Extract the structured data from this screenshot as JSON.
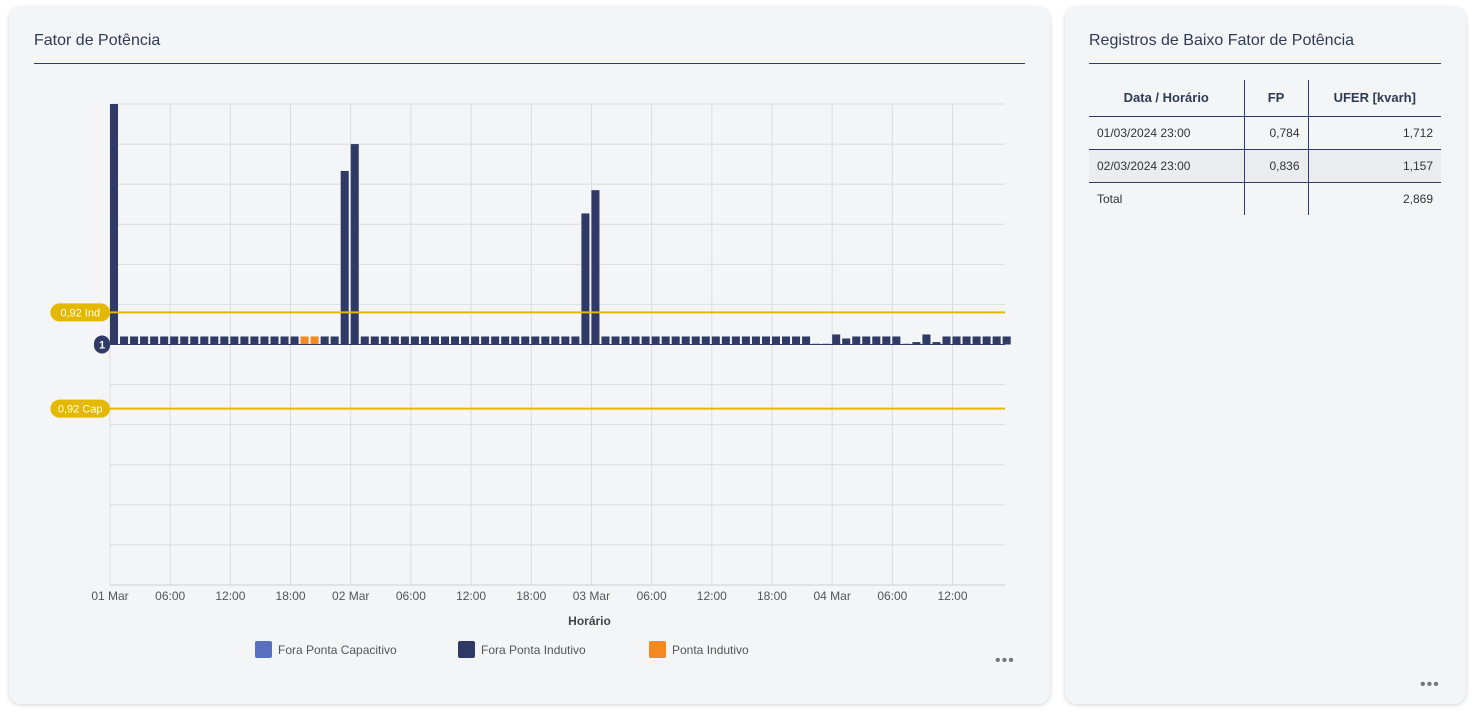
{
  "chart_card": {
    "title": "Fator de Potência",
    "more_label": "•••"
  },
  "table_card": {
    "title": "Registros de Baixo Fator de Potência",
    "more_label": "•••",
    "headers": [
      "Data / Horário",
      "FP",
      "UFER [kvarh]"
    ],
    "rows": [
      {
        "date": "01/03/2024 23:00",
        "fp": "0,784",
        "ufer": "1,712"
      },
      {
        "date": "02/03/2024 23:00",
        "fp": "0,836",
        "ufer": "1,157"
      }
    ],
    "total": {
      "label": "Total",
      "fp": "",
      "ufer": "2,869"
    }
  },
  "chart_data": {
    "type": "bar",
    "xlabel": "Horário",
    "x_ticks": [
      "01 Mar",
      "06:00",
      "12:00",
      "18:00",
      "02 Mar",
      "06:00",
      "12:00",
      "18:00",
      "03 Mar",
      "06:00",
      "12:00",
      "18:00",
      "04 Mar",
      "06:00",
      "12:00"
    ],
    "ylim": [
      0.4,
      1.6
    ],
    "baseline": 1,
    "baseline_label": "1",
    "reference_lines": [
      {
        "label": "0,92 Ind",
        "value": 1.08
      },
      {
        "label": "0,92 Cap",
        "value": 0.84
      }
    ],
    "series": [
      {
        "name": "Fora Ponta Capacitivo",
        "color": "#5a6fbf"
      },
      {
        "name": "Fora Ponta Indutivo",
        "color": "#2f3a66"
      },
      {
        "name": "Ponta Indutivo",
        "color": "#f5891f"
      }
    ],
    "bars": [
      {
        "h": 0,
        "v": 1.6,
        "s": 1
      },
      {
        "h": 1,
        "v": 1.02,
        "s": 1
      },
      {
        "h": 2,
        "v": 1.02,
        "s": 1
      },
      {
        "h": 3,
        "v": 1.02,
        "s": 1
      },
      {
        "h": 4,
        "v": 1.02,
        "s": 1
      },
      {
        "h": 5,
        "v": 1.02,
        "s": 1
      },
      {
        "h": 6,
        "v": 1.02,
        "s": 1
      },
      {
        "h": 7,
        "v": 1.02,
        "s": 1
      },
      {
        "h": 8,
        "v": 1.02,
        "s": 1
      },
      {
        "h": 9,
        "v": 1.02,
        "s": 1
      },
      {
        "h": 10,
        "v": 1.02,
        "s": 1
      },
      {
        "h": 11,
        "v": 1.02,
        "s": 1
      },
      {
        "h": 12,
        "v": 1.02,
        "s": 1
      },
      {
        "h": 13,
        "v": 1.02,
        "s": 1
      },
      {
        "h": 14,
        "v": 1.02,
        "s": 1
      },
      {
        "h": 15,
        "v": 1.02,
        "s": 1
      },
      {
        "h": 16,
        "v": 1.02,
        "s": 1
      },
      {
        "h": 17,
        "v": 1.02,
        "s": 1
      },
      {
        "h": 18,
        "v": 1.02,
        "s": 1
      },
      {
        "h": 19,
        "v": 1.02,
        "s": 2
      },
      {
        "h": 20,
        "v": 1.02,
        "s": 2
      },
      {
        "h": 21,
        "v": 1.02,
        "s": 1
      },
      {
        "h": 22,
        "v": 1.02,
        "s": 1
      },
      {
        "h": 23,
        "v": 1.433,
        "s": 1
      },
      {
        "h": 24,
        "v": 1.5,
        "s": 1
      },
      {
        "h": 25,
        "v": 1.02,
        "s": 1
      },
      {
        "h": 26,
        "v": 1.02,
        "s": 1
      },
      {
        "h": 27,
        "v": 1.02,
        "s": 1
      },
      {
        "h": 28,
        "v": 1.02,
        "s": 1
      },
      {
        "h": 29,
        "v": 1.02,
        "s": 1
      },
      {
        "h": 30,
        "v": 1.02,
        "s": 1
      },
      {
        "h": 31,
        "v": 1.02,
        "s": 1
      },
      {
        "h": 32,
        "v": 1.02,
        "s": 1
      },
      {
        "h": 33,
        "v": 1.02,
        "s": 1
      },
      {
        "h": 34,
        "v": 1.02,
        "s": 1
      },
      {
        "h": 35,
        "v": 1.02,
        "s": 1
      },
      {
        "h": 36,
        "v": 1.02,
        "s": 1
      },
      {
        "h": 37,
        "v": 1.02,
        "s": 1
      },
      {
        "h": 38,
        "v": 1.02,
        "s": 1
      },
      {
        "h": 39,
        "v": 1.02,
        "s": 1
      },
      {
        "h": 40,
        "v": 1.02,
        "s": 1
      },
      {
        "h": 41,
        "v": 1.02,
        "s": 1
      },
      {
        "h": 42,
        "v": 1.02,
        "s": 1
      },
      {
        "h": 43,
        "v": 1.02,
        "s": 1
      },
      {
        "h": 44,
        "v": 1.02,
        "s": 1
      },
      {
        "h": 45,
        "v": 1.02,
        "s": 1
      },
      {
        "h": 46,
        "v": 1.02,
        "s": 1
      },
      {
        "h": 47,
        "v": 1.327,
        "s": 1
      },
      {
        "h": 48,
        "v": 1.385,
        "s": 1
      },
      {
        "h": 49,
        "v": 1.02,
        "s": 1
      },
      {
        "h": 50,
        "v": 1.02,
        "s": 1
      },
      {
        "h": 51,
        "v": 1.02,
        "s": 1
      },
      {
        "h": 52,
        "v": 1.02,
        "s": 1
      },
      {
        "h": 53,
        "v": 1.02,
        "s": 1
      },
      {
        "h": 54,
        "v": 1.02,
        "s": 1
      },
      {
        "h": 55,
        "v": 1.02,
        "s": 1
      },
      {
        "h": 56,
        "v": 1.02,
        "s": 1
      },
      {
        "h": 57,
        "v": 1.02,
        "s": 1
      },
      {
        "h": 58,
        "v": 1.02,
        "s": 1
      },
      {
        "h": 59,
        "v": 1.02,
        "s": 1
      },
      {
        "h": 60,
        "v": 1.02,
        "s": 1
      },
      {
        "h": 61,
        "v": 1.02,
        "s": 1
      },
      {
        "h": 62,
        "v": 1.02,
        "s": 1
      },
      {
        "h": 63,
        "v": 1.02,
        "s": 1
      },
      {
        "h": 64,
        "v": 1.02,
        "s": 1
      },
      {
        "h": 65,
        "v": 1.02,
        "s": 1
      },
      {
        "h": 66,
        "v": 1.02,
        "s": 1
      },
      {
        "h": 67,
        "v": 1.02,
        "s": 1
      },
      {
        "h": 68,
        "v": 1.02,
        "s": 1
      },
      {
        "h": 69,
        "v": 1.02,
        "s": 1
      },
      {
        "h": 70,
        "v": 1.002,
        "s": 0
      },
      {
        "h": 71,
        "v": 1.002,
        "s": 0
      },
      {
        "h": 72,
        "v": 1.025,
        "s": 1
      },
      {
        "h": 73,
        "v": 1.015,
        "s": 1
      },
      {
        "h": 74,
        "v": 1.02,
        "s": 1
      },
      {
        "h": 75,
        "v": 1.02,
        "s": 1
      },
      {
        "h": 76,
        "v": 1.02,
        "s": 1
      },
      {
        "h": 77,
        "v": 1.02,
        "s": 1
      },
      {
        "h": 78,
        "v": 1.02,
        "s": 1
      },
      {
        "h": 79,
        "v": 1.002,
        "s": 0
      },
      {
        "h": 80,
        "v": 1.006,
        "s": 1
      },
      {
        "h": 81,
        "v": 1.025,
        "s": 1
      },
      {
        "h": 82,
        "v": 1.006,
        "s": 1
      },
      {
        "h": 83,
        "v": 1.02,
        "s": 1
      },
      {
        "h": 84,
        "v": 1.02,
        "s": 1
      },
      {
        "h": 85,
        "v": 1.02,
        "s": 1
      },
      {
        "h": 86,
        "v": 1.02,
        "s": 1
      },
      {
        "h": 87,
        "v": 1.02,
        "s": 1
      },
      {
        "h": 88,
        "v": 1.02,
        "s": 1
      },
      {
        "h": 89,
        "v": 1.02,
        "s": 1
      }
    ],
    "grid": true,
    "legend_position": "bottom"
  }
}
